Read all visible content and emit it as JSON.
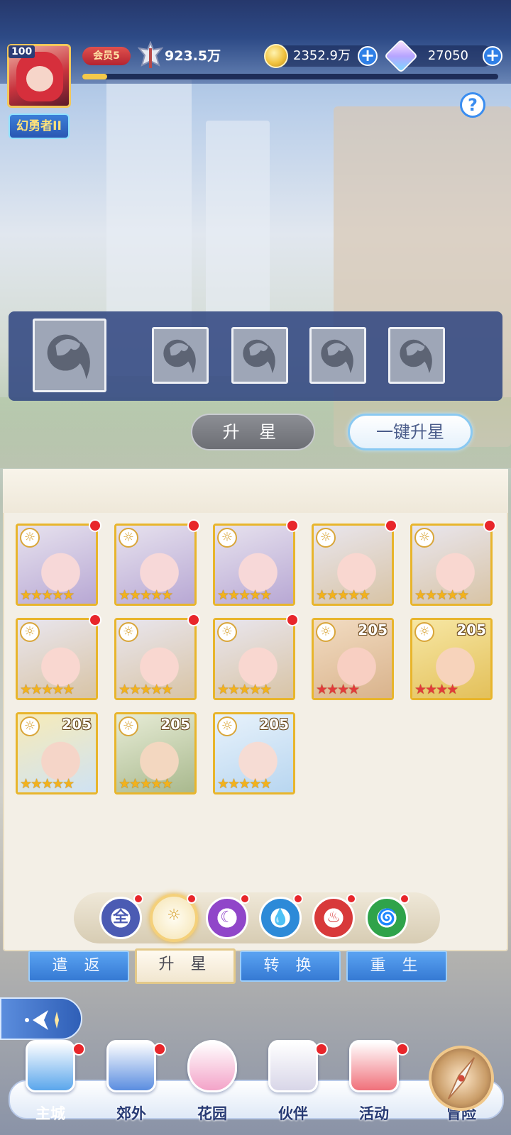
{
  "player": {
    "level": "100",
    "rank_title": "幻勇者II",
    "vip_label": "会员5",
    "power": "923.5万"
  },
  "currency": {
    "gold": "2352.9万",
    "diamond": "27050"
  },
  "exp_progress": 0.06,
  "help_label": "?",
  "slot_panel": {
    "main_slot": "hero-silhouette-icon",
    "sub_slots": 4
  },
  "actions": {
    "star_up": "升 星",
    "one_key_star_up": "一键升星"
  },
  "heroes": [
    {
      "stars": "★★★★★",
      "star_color": "gold",
      "level": "",
      "has_dot": true,
      "palette": "silver-purple"
    },
    {
      "stars": "★★★★★",
      "star_color": "gold",
      "level": "",
      "has_dot": true,
      "palette": "silver-purple"
    },
    {
      "stars": "★★★★★",
      "star_color": "gold",
      "level": "",
      "has_dot": true,
      "palette": "silver-purple"
    },
    {
      "stars": "★★★★★",
      "star_color": "gold",
      "level": "",
      "has_dot": true,
      "palette": "silver-gold"
    },
    {
      "stars": "★★★★★",
      "star_color": "gold",
      "level": "",
      "has_dot": true,
      "palette": "silver-gold"
    },
    {
      "stars": "★★★★★",
      "star_color": "gold",
      "level": "",
      "has_dot": true,
      "palette": "silver-gold"
    },
    {
      "stars": "★★★★★",
      "star_color": "gold",
      "level": "",
      "has_dot": true,
      "palette": "silver-gold"
    },
    {
      "stars": "★★★★★",
      "star_color": "gold",
      "level": "",
      "has_dot": true,
      "palette": "silver-gold"
    },
    {
      "stars": "★★★★",
      "star_color": "red",
      "level": "205",
      "has_dot": false,
      "palette": "blonde-pink"
    },
    {
      "stars": "★★★★",
      "star_color": "red",
      "level": "205",
      "has_dot": false,
      "palette": "blonde-yellow"
    },
    {
      "stars": "★★★★★",
      "star_color": "gold",
      "level": "205",
      "has_dot": false,
      "palette": "blonde-blue"
    },
    {
      "stars": "★★★★★",
      "star_color": "gold",
      "level": "205",
      "has_dot": false,
      "palette": "sage-green"
    },
    {
      "stars": "★★★★★",
      "star_color": "gold",
      "level": "205",
      "has_dot": false,
      "palette": "ice-blue"
    }
  ],
  "filters": [
    {
      "label": "全",
      "icon": "all-filter-icon",
      "color": "#4b5bb3",
      "selected": false
    },
    {
      "label": "☼",
      "icon": "light-element-icon",
      "color": "#d9a63a",
      "selected": true
    },
    {
      "label": "☾",
      "icon": "dark-element-icon",
      "color": "#9046c9",
      "selected": false
    },
    {
      "label": "💧",
      "icon": "water-element-icon",
      "color": "#2d8ad8",
      "selected": false
    },
    {
      "label": "♨",
      "icon": "fire-element-icon",
      "color": "#d8393a",
      "selected": false
    },
    {
      "label": "🌀",
      "icon": "wind-element-icon",
      "color": "#2fa34a",
      "selected": false
    }
  ],
  "tabs": [
    "遣 返",
    "升 星",
    "转 换",
    "重 生"
  ],
  "active_tab": 1,
  "back_icon": "back-arrow-icon",
  "nav": [
    {
      "label": "主城",
      "icon": "castle-icon"
    },
    {
      "label": "郊外",
      "icon": "magic-circle-icon"
    },
    {
      "label": "花园",
      "icon": "heart-garden-icon"
    },
    {
      "label": "伙伴",
      "icon": "partner-portrait-icon"
    },
    {
      "label": "活动",
      "icon": "gift-box-icon"
    },
    {
      "label": "冒险",
      "icon": "compass-sword-icon"
    }
  ]
}
